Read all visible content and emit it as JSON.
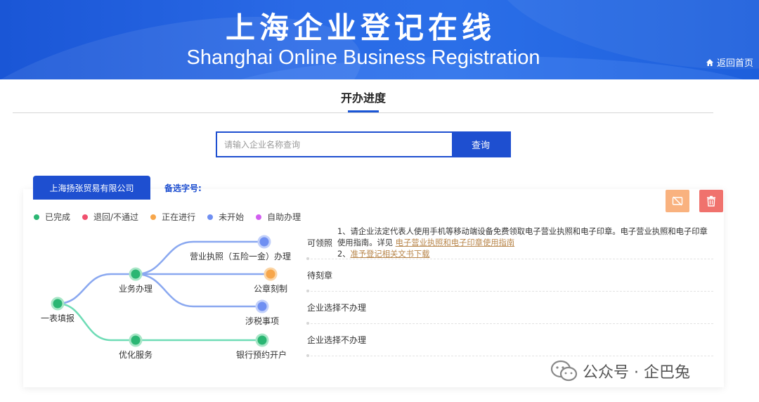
{
  "banner": {
    "title": "上海企业登记在线",
    "subtitle": "Shanghai Online Business Registration",
    "home_link": "返回首页"
  },
  "tabs": {
    "progress": "开办进度"
  },
  "search": {
    "placeholder": "请输入企业名称查询",
    "button": "查询"
  },
  "company": {
    "name": "上海扬张贸易有限公司",
    "alt_name_label": "备选字号:"
  },
  "legend": [
    {
      "label": "已完成",
      "color": "#2bb673"
    },
    {
      "label": "退回/不通过",
      "color": "#f0506e"
    },
    {
      "label": "正在进行",
      "color": "#f7a64a"
    },
    {
      "label": "未开始",
      "color": "#6f8ff2"
    },
    {
      "label": "自助办理",
      "color": "#d25ef0"
    }
  ],
  "tree": {
    "root": "一表填报",
    "business": "业务办理",
    "optimize": "优化服务",
    "license": "营业执照（五险一金）办理",
    "seal": "公章刻制",
    "tax": "涉税事项",
    "bank": "银行预约开户"
  },
  "rows": [
    {
      "status": "可领照"
    },
    {
      "status": "待刻章"
    },
    {
      "status": "企业选择不办理"
    },
    {
      "status": "企业选择不办理"
    }
  ],
  "notes": {
    "line1_prefix": "1、请企业法定代表人使用手机等移动端设备免费领取电子营业执照和电子印章。电子营业执照和电子印章使用指南。详见 ",
    "line1_link": "电子营业执照和电子印章使用指南",
    "line2_prefix": "2、",
    "line2_link": "准予登记相关文书下载"
  },
  "watermark": {
    "text": "公众号 · 企巴兔"
  },
  "colors": {
    "primary": "#1e4fd0",
    "done": "#2bb673",
    "in_progress": "#f7a64a",
    "not_started": "#6f8ff2",
    "line_blue": "#8aa8f0",
    "line_green": "#6fdcb6"
  }
}
